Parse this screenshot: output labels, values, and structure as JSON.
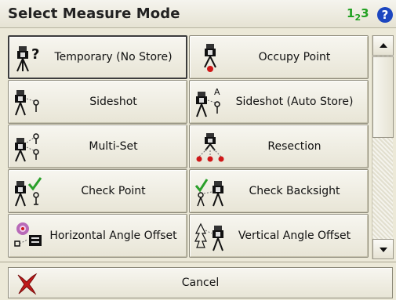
{
  "window": {
    "title": "Select Measure Mode",
    "numeric_indicator": {
      "base": "1",
      "sub": "2",
      "tail": "3"
    },
    "help_glyph": "?"
  },
  "modes": [
    {
      "label": "Temporary (No Store)",
      "icon": "instrument-question-icon",
      "selected": true
    },
    {
      "label": "Occupy Point",
      "icon": "instrument-occupy-icon",
      "selected": false
    },
    {
      "label": "Sideshot",
      "icon": "instrument-sideshot-icon",
      "selected": false
    },
    {
      "label": "Sideshot (Auto Store)",
      "icon": "instrument-sideshot-auto-icon",
      "selected": false
    },
    {
      "label": "Multi-Set",
      "icon": "instrument-multiset-icon",
      "selected": false
    },
    {
      "label": "Resection",
      "icon": "instrument-resection-icon",
      "selected": false
    },
    {
      "label": "Check Point",
      "icon": "instrument-checkpoint-icon",
      "selected": false
    },
    {
      "label": "Check Backsight",
      "icon": "instrument-check-backsight-icon",
      "selected": false
    },
    {
      "label": "Horizontal Angle Offset",
      "icon": "horizontal-angle-offset-icon",
      "selected": false
    },
    {
      "label": "Vertical Angle Offset",
      "icon": "vertical-angle-offset-icon",
      "selected": false
    }
  ],
  "footer": {
    "cancel_label": "Cancel",
    "cancel_icon": "red-x-icon"
  },
  "colors": {
    "background": "#ece9d8",
    "numeric_indicator": "#20a020",
    "help": "#1c46c0",
    "cancel_x": "#c01818"
  }
}
